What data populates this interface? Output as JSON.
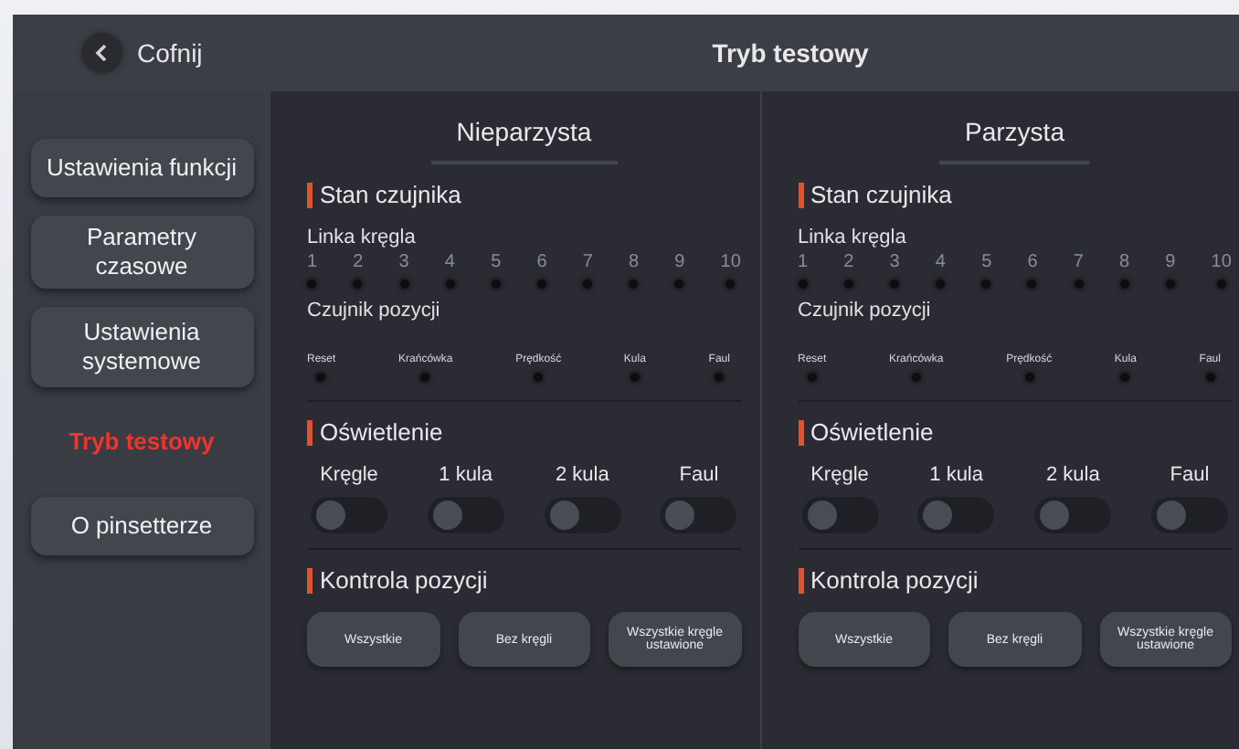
{
  "header": {
    "back": "Cofnij",
    "title": "Tryb testowy"
  },
  "sidebar": {
    "items": [
      {
        "label": "Ustawienia funkcji",
        "selected": false
      },
      {
        "label": "Parametry czasowe",
        "selected": false
      },
      {
        "label": "Ustawienia systemowe",
        "selected": false
      },
      {
        "label": "Tryb testowy",
        "selected": true
      },
      {
        "label": "O pinsetterze",
        "selected": false
      }
    ]
  },
  "panels": [
    {
      "title": "Nieparzysta",
      "sensor_title": "Stan czujnika",
      "pin_line_label": "Linka kręgla",
      "pins": [
        {
          "label": "1",
          "on": false
        },
        {
          "label": "2",
          "on": false
        },
        {
          "label": "3",
          "on": false
        },
        {
          "label": "4",
          "on": false
        },
        {
          "label": "5",
          "on": false
        },
        {
          "label": "6",
          "on": false
        },
        {
          "label": "7",
          "on": false
        },
        {
          "label": "8",
          "on": false
        },
        {
          "label": "9",
          "on": false
        },
        {
          "label": "10",
          "on": false
        }
      ],
      "position_label": "Czujnik pozycji",
      "position_sensors": [
        {
          "label": "Reset",
          "on": false
        },
        {
          "label": "Krańcówka",
          "on": false
        },
        {
          "label": "Prędkość",
          "on": false
        },
        {
          "label": "Kula",
          "on": false
        },
        {
          "label": "Faul",
          "on": false
        }
      ],
      "lighting_title": "Oświetlenie",
      "lights": [
        {
          "label": "Kręgle",
          "on": false
        },
        {
          "label": "1 kula",
          "on": false
        },
        {
          "label": "2 kula",
          "on": false
        },
        {
          "label": "Faul",
          "on": false
        }
      ],
      "control_title": "Kontrola pozycji",
      "buttons": [
        "Wszystkie",
        "Bez kręgli",
        "Wszystkie kręgle ustawione"
      ]
    },
    {
      "title": "Parzysta",
      "sensor_title": "Stan czujnika",
      "pin_line_label": "Linka kręgla",
      "pins": [
        {
          "label": "1",
          "on": false
        },
        {
          "label": "2",
          "on": false
        },
        {
          "label": "3",
          "on": false
        },
        {
          "label": "4",
          "on": false
        },
        {
          "label": "5",
          "on": false
        },
        {
          "label": "6",
          "on": false
        },
        {
          "label": "7",
          "on": false
        },
        {
          "label": "8",
          "on": false
        },
        {
          "label": "9",
          "on": false
        },
        {
          "label": "10",
          "on": false
        }
      ],
      "position_label": "Czujnik pozycji",
      "position_sensors": [
        {
          "label": "Reset",
          "on": false
        },
        {
          "label": "Krańcówka",
          "on": false
        },
        {
          "label": "Prędkość",
          "on": false
        },
        {
          "label": "Kula",
          "on": false
        },
        {
          "label": "Faul",
          "on": false
        }
      ],
      "lighting_title": "Oświetlenie",
      "lights": [
        {
          "label": "Kręgle",
          "on": false
        },
        {
          "label": "1 kula",
          "on": false
        },
        {
          "label": "2 kula",
          "on": false
        },
        {
          "label": "Faul",
          "on": false
        }
      ],
      "control_title": "Kontrola pozycji",
      "buttons": [
        "Wszystkie",
        "Bez kręgli",
        "Wszystkie kręgle ustawione"
      ]
    }
  ]
}
